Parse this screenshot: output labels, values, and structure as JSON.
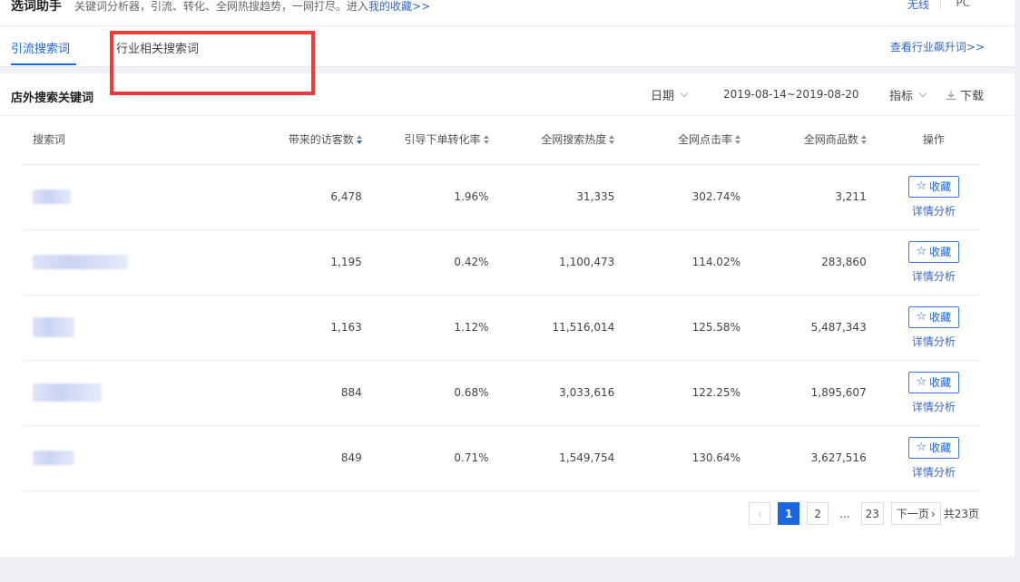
{
  "header": {
    "title": "选词助手",
    "description": "关键词分析器，引流、转化、全网热搜趋势，一网打尽。进入",
    "collection_link": "我的收藏>>",
    "terminal_wireless": "无线",
    "terminal_pc": "PC"
  },
  "tabs": [
    {
      "label": "引流搜索词",
      "active": true
    },
    {
      "label": "行业相关搜索词",
      "active": false
    }
  ],
  "trend_link": "查看行业飙升词>>",
  "section": {
    "title": "店外搜索关键词",
    "date_label": "日期",
    "date_range": "2019-08-14~2019-08-20",
    "metric_label": "指标",
    "download_label": "下载"
  },
  "table": {
    "columns": [
      "搜索词",
      "带来的访客数",
      "引导下单转化率",
      "全网搜索热度",
      "全网点击率",
      "全网商品数",
      "操作"
    ],
    "rows": [
      {
        "visitors": "6,478",
        "conversion": "1.96%",
        "heat": "31,335",
        "ctr": "302.74%",
        "products": "3,211"
      },
      {
        "visitors": "1,195",
        "conversion": "0.42%",
        "heat": "1,100,473",
        "ctr": "114.02%",
        "products": "283,860"
      },
      {
        "visitors": "1,163",
        "conversion": "1.12%",
        "heat": "11,516,014",
        "ctr": "125.58%",
        "products": "5,487,343"
      },
      {
        "visitors": "884",
        "conversion": "0.68%",
        "heat": "3,033,616",
        "ctr": "122.25%",
        "products": "1,895,607"
      },
      {
        "visitors": "849",
        "conversion": "0.71%",
        "heat": "1,549,754",
        "ctr": "130.64%",
        "products": "3,627,516"
      }
    ],
    "fav_label": "收藏",
    "detail_label": "详情分析"
  },
  "pagination": {
    "prev": "‹",
    "pages": [
      "1",
      "2",
      "...",
      "23"
    ],
    "current": "1",
    "next": "下一页",
    "total": "共23页"
  },
  "icons": {
    "star": "star-icon",
    "download": "download-icon",
    "chevron": "chevron-down-icon"
  },
  "colors": {
    "accent": "#1a66e0",
    "annotation_box": "#ee3a3a"
  }
}
